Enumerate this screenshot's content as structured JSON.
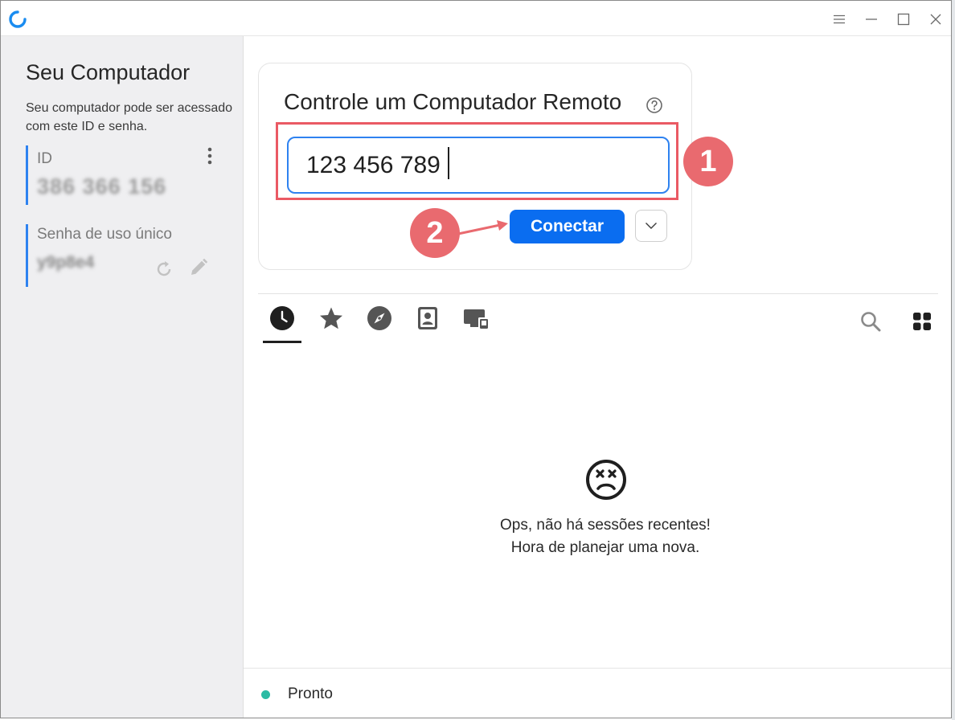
{
  "colors": {
    "accent": "#0a6df0",
    "highlight": "#ea5a64",
    "step_circle": "#e96a6f",
    "status_ok": "#2bbba4",
    "sidebar_bg": "#efeff1"
  },
  "titlebar": {
    "logo_icon": "rustdesk-logo-icon",
    "controls": [
      "menu-icon",
      "minimize-icon",
      "maximize-icon",
      "close-icon"
    ]
  },
  "sidebar": {
    "title": "Seu Computador",
    "description": "Seu computador pode ser acessado com este ID e senha.",
    "id_label": "ID",
    "id_value": "386 366 156",
    "password_label": "Senha de uso único",
    "password_value": "y9p8e4"
  },
  "remote": {
    "title": "Controle um Computador Remoto",
    "id_input_value": "123 456 789",
    "connect_label": "Conectar",
    "step1": "1",
    "step2": "2"
  },
  "tabs": {
    "items": [
      "recent-sessions-icon",
      "favorites-icon",
      "discovered-icon",
      "address-book-icon",
      "group-icon"
    ],
    "active": "recent-sessions-icon"
  },
  "empty_state": {
    "line1": "Ops, não há sessões recentes!",
    "line2": "Hora de planejar uma nova."
  },
  "status": {
    "text": "Pronto"
  }
}
